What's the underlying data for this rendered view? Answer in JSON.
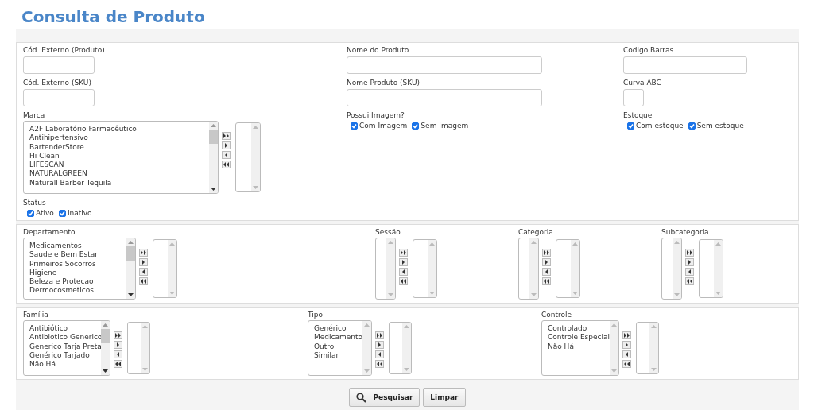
{
  "title": "Consulta de Produto",
  "sections": [
    {
      "columns": [
        [
          {
            "kind": "input",
            "label": "Cód. Externo (Produto)"
          },
          {
            "kind": "input",
            "label": "Cód. Externo (SKU)"
          },
          {
            "kind": "dual_list",
            "label": "Marca",
            "scrollable": true,
            "items": [
              "A2F Laboratório Farmacêutico",
              "Antihipertensivo",
              "BartenderStore",
              "Hi Clean",
              "LIFESCAN",
              "NATURALGREEN",
              "Naturall Barber Tequila"
            ]
          },
          {
            "kind": "checks",
            "label": "Status",
            "options": [
              {
                "label": "Ativo",
                "checked": true
              },
              {
                "label": "Inativo",
                "checked": true
              }
            ]
          }
        ],
        [
          {
            "kind": "input",
            "label": "Nome do Produto"
          },
          {
            "kind": "input",
            "label": "Nome Produto (SKU)"
          },
          {
            "kind": "checks",
            "label": "Possui Imagem?",
            "options": [
              {
                "label": "Com Imagem",
                "checked": true
              },
              {
                "label": "Sem Imagem",
                "checked": true
              }
            ]
          }
        ],
        [
          {
            "kind": "input",
            "label": "Codigo Barras"
          },
          {
            "kind": "input",
            "label": "Curva ABC"
          },
          {
            "kind": "checks",
            "label": "Estoque",
            "options": [
              {
                "label": "Com estoque",
                "checked": true
              },
              {
                "label": "Sem estoque",
                "checked": true
              }
            ]
          }
        ]
      ]
    },
    {
      "columns": [
        [
          {
            "kind": "dual_list",
            "label": "Departamento",
            "scrollable": true,
            "items": [
              "Medicamentos",
              "Saude e Bem Estar",
              "Primeiros Socorros",
              "Higiene",
              "Beleza e Protecao",
              "Dermocosmeticos"
            ]
          }
        ],
        [
          {
            "kind": "dual_list",
            "label": "Sessão",
            "scrollable": false
          }
        ],
        [
          {
            "kind": "dual_list",
            "label": "Categoria",
            "scrollable": false
          }
        ],
        [
          {
            "kind": "dual_list",
            "label": "Subcategoria",
            "scrollable": false
          }
        ]
      ]
    },
    {
      "columns": [
        [
          {
            "kind": "dual_list",
            "label": "Família",
            "scrollable": true,
            "items": [
              "Antibiótico",
              "Antibiotico Generico",
              "Generico Tarja Preta",
              "Genérico Tarjado",
              "Não Há"
            ]
          }
        ],
        [
          {
            "kind": "dual_list",
            "label": "Tipo",
            "scrollable": false,
            "items": [
              "Genérico",
              "Medicamento",
              "Outro",
              "Similar"
            ]
          }
        ],
        [
          {
            "kind": "dual_list",
            "label": "Controle",
            "scrollable": false,
            "items": [
              "Controlado",
              "Controle Especial",
              "Não Há"
            ]
          }
        ]
      ]
    }
  ],
  "buttons": [
    {
      "kind": "search",
      "label": "Pesquisar"
    },
    {
      "kind": "plain",
      "label": "Limpar"
    }
  ]
}
